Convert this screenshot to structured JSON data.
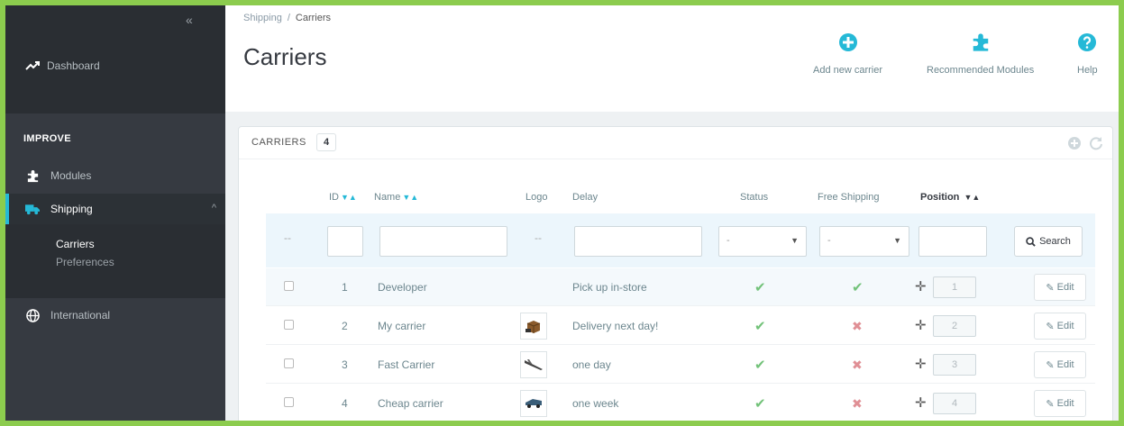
{
  "sidebar": {
    "collapse": "«",
    "dashboard": "Dashboard",
    "section": "IMPROVE",
    "items": [
      {
        "label": "Modules"
      },
      {
        "label": "Shipping",
        "chevron": "^"
      },
      {
        "label": "International"
      }
    ],
    "sub_items": [
      {
        "label": "Carriers"
      },
      {
        "label": "Preferences"
      }
    ]
  },
  "header": {
    "breadcrumb": [
      "Shipping",
      "Carriers"
    ],
    "breadcrumb_sep": "/",
    "title": "Carriers",
    "toolbar": [
      {
        "label": "Add new carrier",
        "icon": "plus-circle-icon"
      },
      {
        "label": "Recommended Modules",
        "icon": "puzzle-icon"
      },
      {
        "label": "Help",
        "icon": "question-circle-icon"
      }
    ]
  },
  "panel": {
    "title": "CARRIERS",
    "count": "4",
    "columns": {
      "id": "ID",
      "name": "Name",
      "logo": "Logo",
      "delay": "Delay",
      "status": "Status",
      "free_shipping": "Free Shipping",
      "position": "Position",
      "sort_indicator": "▼▲"
    },
    "filters": {
      "dash": "--",
      "status_value": "-",
      "free_shipping_value": "-",
      "search_label": "Search"
    },
    "rows": [
      {
        "id": "1",
        "name": "Developer",
        "logo": "none",
        "delay": "Pick up in-store",
        "status": "enabled",
        "free_shipping": "yes",
        "position": "1",
        "edit": "Edit"
      },
      {
        "id": "2",
        "name": "My carrier",
        "logo": "box",
        "delay": "Delivery next day!",
        "status": "enabled",
        "free_shipping": "no",
        "position": "2",
        "edit": "Edit"
      },
      {
        "id": "3",
        "name": "Fast Carrier",
        "logo": "plane",
        "delay": "one day",
        "status": "enabled",
        "free_shipping": "no",
        "position": "3",
        "edit": "Edit"
      },
      {
        "id": "4",
        "name": "Cheap carrier",
        "logo": "truck",
        "delay": "one week",
        "status": "enabled",
        "free_shipping": "no",
        "position": "4",
        "edit": "Edit"
      }
    ]
  },
  "colors": {
    "accent": "#25b9d7",
    "sidebar": "#363a41",
    "check": "#72c279",
    "cross": "#e08f95",
    "frame": "#8ccc4e"
  }
}
